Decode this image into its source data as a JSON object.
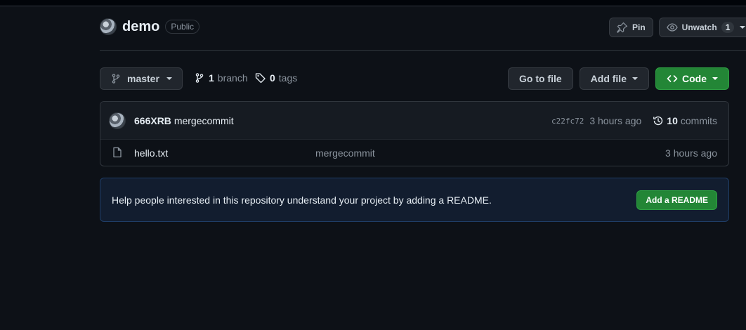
{
  "repo": {
    "name": "demo",
    "visibility": "Public"
  },
  "header_actions": {
    "pin_label": "Pin",
    "unwatch_label": "Unwatch",
    "watch_count": "1"
  },
  "branch_bar": {
    "current_branch": "master",
    "branch_count": "1",
    "branch_label": "branch",
    "tag_count": "0",
    "tag_label": "tags",
    "go_to_file": "Go to file",
    "add_file": "Add file",
    "code": "Code"
  },
  "latest_commit": {
    "author": "666XRB",
    "message": "mergecommit",
    "sha": "c22fc72",
    "time": "3 hours ago",
    "commit_count": "10",
    "commit_label": "commits"
  },
  "files": [
    {
      "name": "hello.txt",
      "message": "mergecommit",
      "time": "3 hours ago"
    }
  ],
  "readme_banner": {
    "text": "Help people interested in this repository understand your project by adding a README.",
    "button": "Add a README"
  },
  "colors": {
    "background": "#0d1117",
    "primary_green": "#238636",
    "banner_bg": "#121d2f"
  }
}
